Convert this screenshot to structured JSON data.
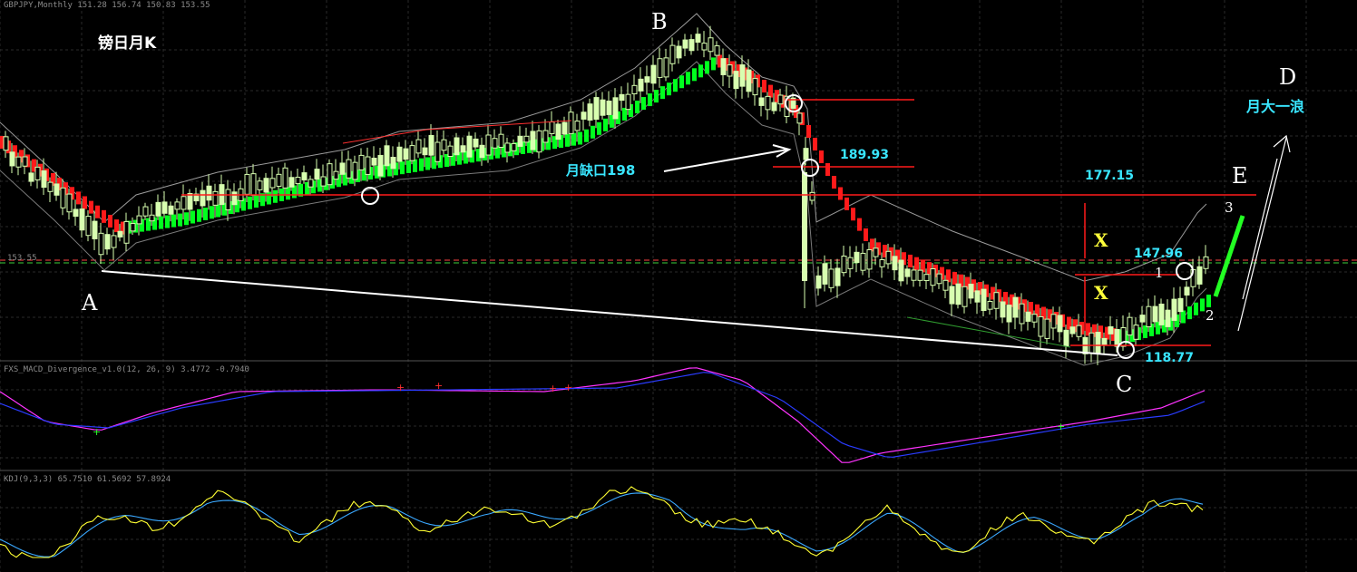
{
  "window": {
    "symbol_header": "GBPJPY,Monthly  151.28 156.74 150.83 153.55",
    "macd_header": "FXS_MACD_Divergence_v1.0(12, 26, 9) 3.4772 -0.7940",
    "kdj_header": "KDJ(9,3,3) 65.7510 61.5692 57.8924",
    "price_line_label": "153.55"
  },
  "annotations": {
    "title": "镑日月K",
    "gap_label": "月缺口198",
    "wave_label": "月大一浪",
    "points": {
      "A": "A",
      "B": "B",
      "C": "C",
      "D": "D",
      "E": "E"
    },
    "steps": {
      "s1": "1",
      "s2": "2",
      "s3": "3"
    },
    "x_marks": {
      "x1": "X",
      "x2": "X"
    },
    "levels": {
      "l189": "189.93",
      "l177": "177.15",
      "l147": "147.96",
      "l118": "118.77"
    }
  },
  "colors": {
    "bull_candle": "#00ff1e",
    "bear_candle": "#ff1a1a",
    "outline_candle": "#d8ffb0",
    "horizontal_line": "#ff1a1a",
    "trend_line": "#ffffff",
    "macd_line": "#ff33ff",
    "signal_line": "#2a3cff",
    "k_line": "#ffff33",
    "d_line": "#3aa8ff",
    "grid": "#2a2a2a",
    "annotation_cyan": "#39e6ff",
    "annotation_yellow": "#ffff3a"
  },
  "chart_data": {
    "type": "candlestick",
    "symbol": "GBPJPY",
    "timeframe": "Monthly",
    "levels": [
      189.93,
      177.15,
      147.96,
      118.77
    ],
    "ohlc_last": {
      "open": 151.28,
      "high": 156.74,
      "low": 150.83,
      "close": 153.55
    },
    "indicators": {
      "macd": {
        "value": 3.4772,
        "signal": -0.794
      },
      "kdj": {
        "k": 65.751,
        "d": 61.5692,
        "j": 57.8924
      }
    }
  }
}
